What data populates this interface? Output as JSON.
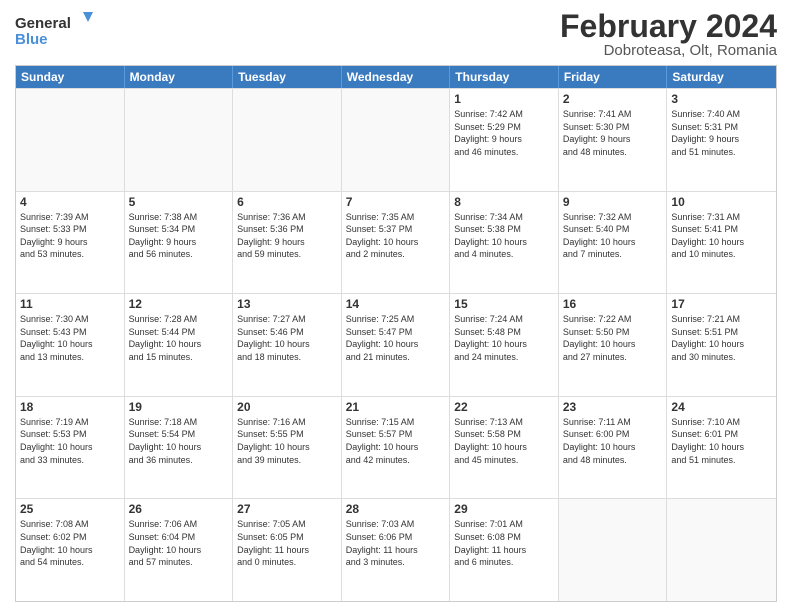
{
  "logo": {
    "line1": "General",
    "line2": "Blue"
  },
  "title": "February 2024",
  "location": "Dobroteasa, Olt, Romania",
  "days_of_week": [
    "Sunday",
    "Monday",
    "Tuesday",
    "Wednesday",
    "Thursday",
    "Friday",
    "Saturday"
  ],
  "weeks": [
    [
      {
        "day": "",
        "info": ""
      },
      {
        "day": "",
        "info": ""
      },
      {
        "day": "",
        "info": ""
      },
      {
        "day": "",
        "info": ""
      },
      {
        "day": "1",
        "info": "Sunrise: 7:42 AM\nSunset: 5:29 PM\nDaylight: 9 hours\nand 46 minutes."
      },
      {
        "day": "2",
        "info": "Sunrise: 7:41 AM\nSunset: 5:30 PM\nDaylight: 9 hours\nand 48 minutes."
      },
      {
        "day": "3",
        "info": "Sunrise: 7:40 AM\nSunset: 5:31 PM\nDaylight: 9 hours\nand 51 minutes."
      }
    ],
    [
      {
        "day": "4",
        "info": "Sunrise: 7:39 AM\nSunset: 5:33 PM\nDaylight: 9 hours\nand 53 minutes."
      },
      {
        "day": "5",
        "info": "Sunrise: 7:38 AM\nSunset: 5:34 PM\nDaylight: 9 hours\nand 56 minutes."
      },
      {
        "day": "6",
        "info": "Sunrise: 7:36 AM\nSunset: 5:36 PM\nDaylight: 9 hours\nand 59 minutes."
      },
      {
        "day": "7",
        "info": "Sunrise: 7:35 AM\nSunset: 5:37 PM\nDaylight: 10 hours\nand 2 minutes."
      },
      {
        "day": "8",
        "info": "Sunrise: 7:34 AM\nSunset: 5:38 PM\nDaylight: 10 hours\nand 4 minutes."
      },
      {
        "day": "9",
        "info": "Sunrise: 7:32 AM\nSunset: 5:40 PM\nDaylight: 10 hours\nand 7 minutes."
      },
      {
        "day": "10",
        "info": "Sunrise: 7:31 AM\nSunset: 5:41 PM\nDaylight: 10 hours\nand 10 minutes."
      }
    ],
    [
      {
        "day": "11",
        "info": "Sunrise: 7:30 AM\nSunset: 5:43 PM\nDaylight: 10 hours\nand 13 minutes."
      },
      {
        "day": "12",
        "info": "Sunrise: 7:28 AM\nSunset: 5:44 PM\nDaylight: 10 hours\nand 15 minutes."
      },
      {
        "day": "13",
        "info": "Sunrise: 7:27 AM\nSunset: 5:46 PM\nDaylight: 10 hours\nand 18 minutes."
      },
      {
        "day": "14",
        "info": "Sunrise: 7:25 AM\nSunset: 5:47 PM\nDaylight: 10 hours\nand 21 minutes."
      },
      {
        "day": "15",
        "info": "Sunrise: 7:24 AM\nSunset: 5:48 PM\nDaylight: 10 hours\nand 24 minutes."
      },
      {
        "day": "16",
        "info": "Sunrise: 7:22 AM\nSunset: 5:50 PM\nDaylight: 10 hours\nand 27 minutes."
      },
      {
        "day": "17",
        "info": "Sunrise: 7:21 AM\nSunset: 5:51 PM\nDaylight: 10 hours\nand 30 minutes."
      }
    ],
    [
      {
        "day": "18",
        "info": "Sunrise: 7:19 AM\nSunset: 5:53 PM\nDaylight: 10 hours\nand 33 minutes."
      },
      {
        "day": "19",
        "info": "Sunrise: 7:18 AM\nSunset: 5:54 PM\nDaylight: 10 hours\nand 36 minutes."
      },
      {
        "day": "20",
        "info": "Sunrise: 7:16 AM\nSunset: 5:55 PM\nDaylight: 10 hours\nand 39 minutes."
      },
      {
        "day": "21",
        "info": "Sunrise: 7:15 AM\nSunset: 5:57 PM\nDaylight: 10 hours\nand 42 minutes."
      },
      {
        "day": "22",
        "info": "Sunrise: 7:13 AM\nSunset: 5:58 PM\nDaylight: 10 hours\nand 45 minutes."
      },
      {
        "day": "23",
        "info": "Sunrise: 7:11 AM\nSunset: 6:00 PM\nDaylight: 10 hours\nand 48 minutes."
      },
      {
        "day": "24",
        "info": "Sunrise: 7:10 AM\nSunset: 6:01 PM\nDaylight: 10 hours\nand 51 minutes."
      }
    ],
    [
      {
        "day": "25",
        "info": "Sunrise: 7:08 AM\nSunset: 6:02 PM\nDaylight: 10 hours\nand 54 minutes."
      },
      {
        "day": "26",
        "info": "Sunrise: 7:06 AM\nSunset: 6:04 PM\nDaylight: 10 hours\nand 57 minutes."
      },
      {
        "day": "27",
        "info": "Sunrise: 7:05 AM\nSunset: 6:05 PM\nDaylight: 11 hours\nand 0 minutes."
      },
      {
        "day": "28",
        "info": "Sunrise: 7:03 AM\nSunset: 6:06 PM\nDaylight: 11 hours\nand 3 minutes."
      },
      {
        "day": "29",
        "info": "Sunrise: 7:01 AM\nSunset: 6:08 PM\nDaylight: 11 hours\nand 6 minutes."
      },
      {
        "day": "",
        "info": ""
      },
      {
        "day": "",
        "info": ""
      }
    ]
  ]
}
